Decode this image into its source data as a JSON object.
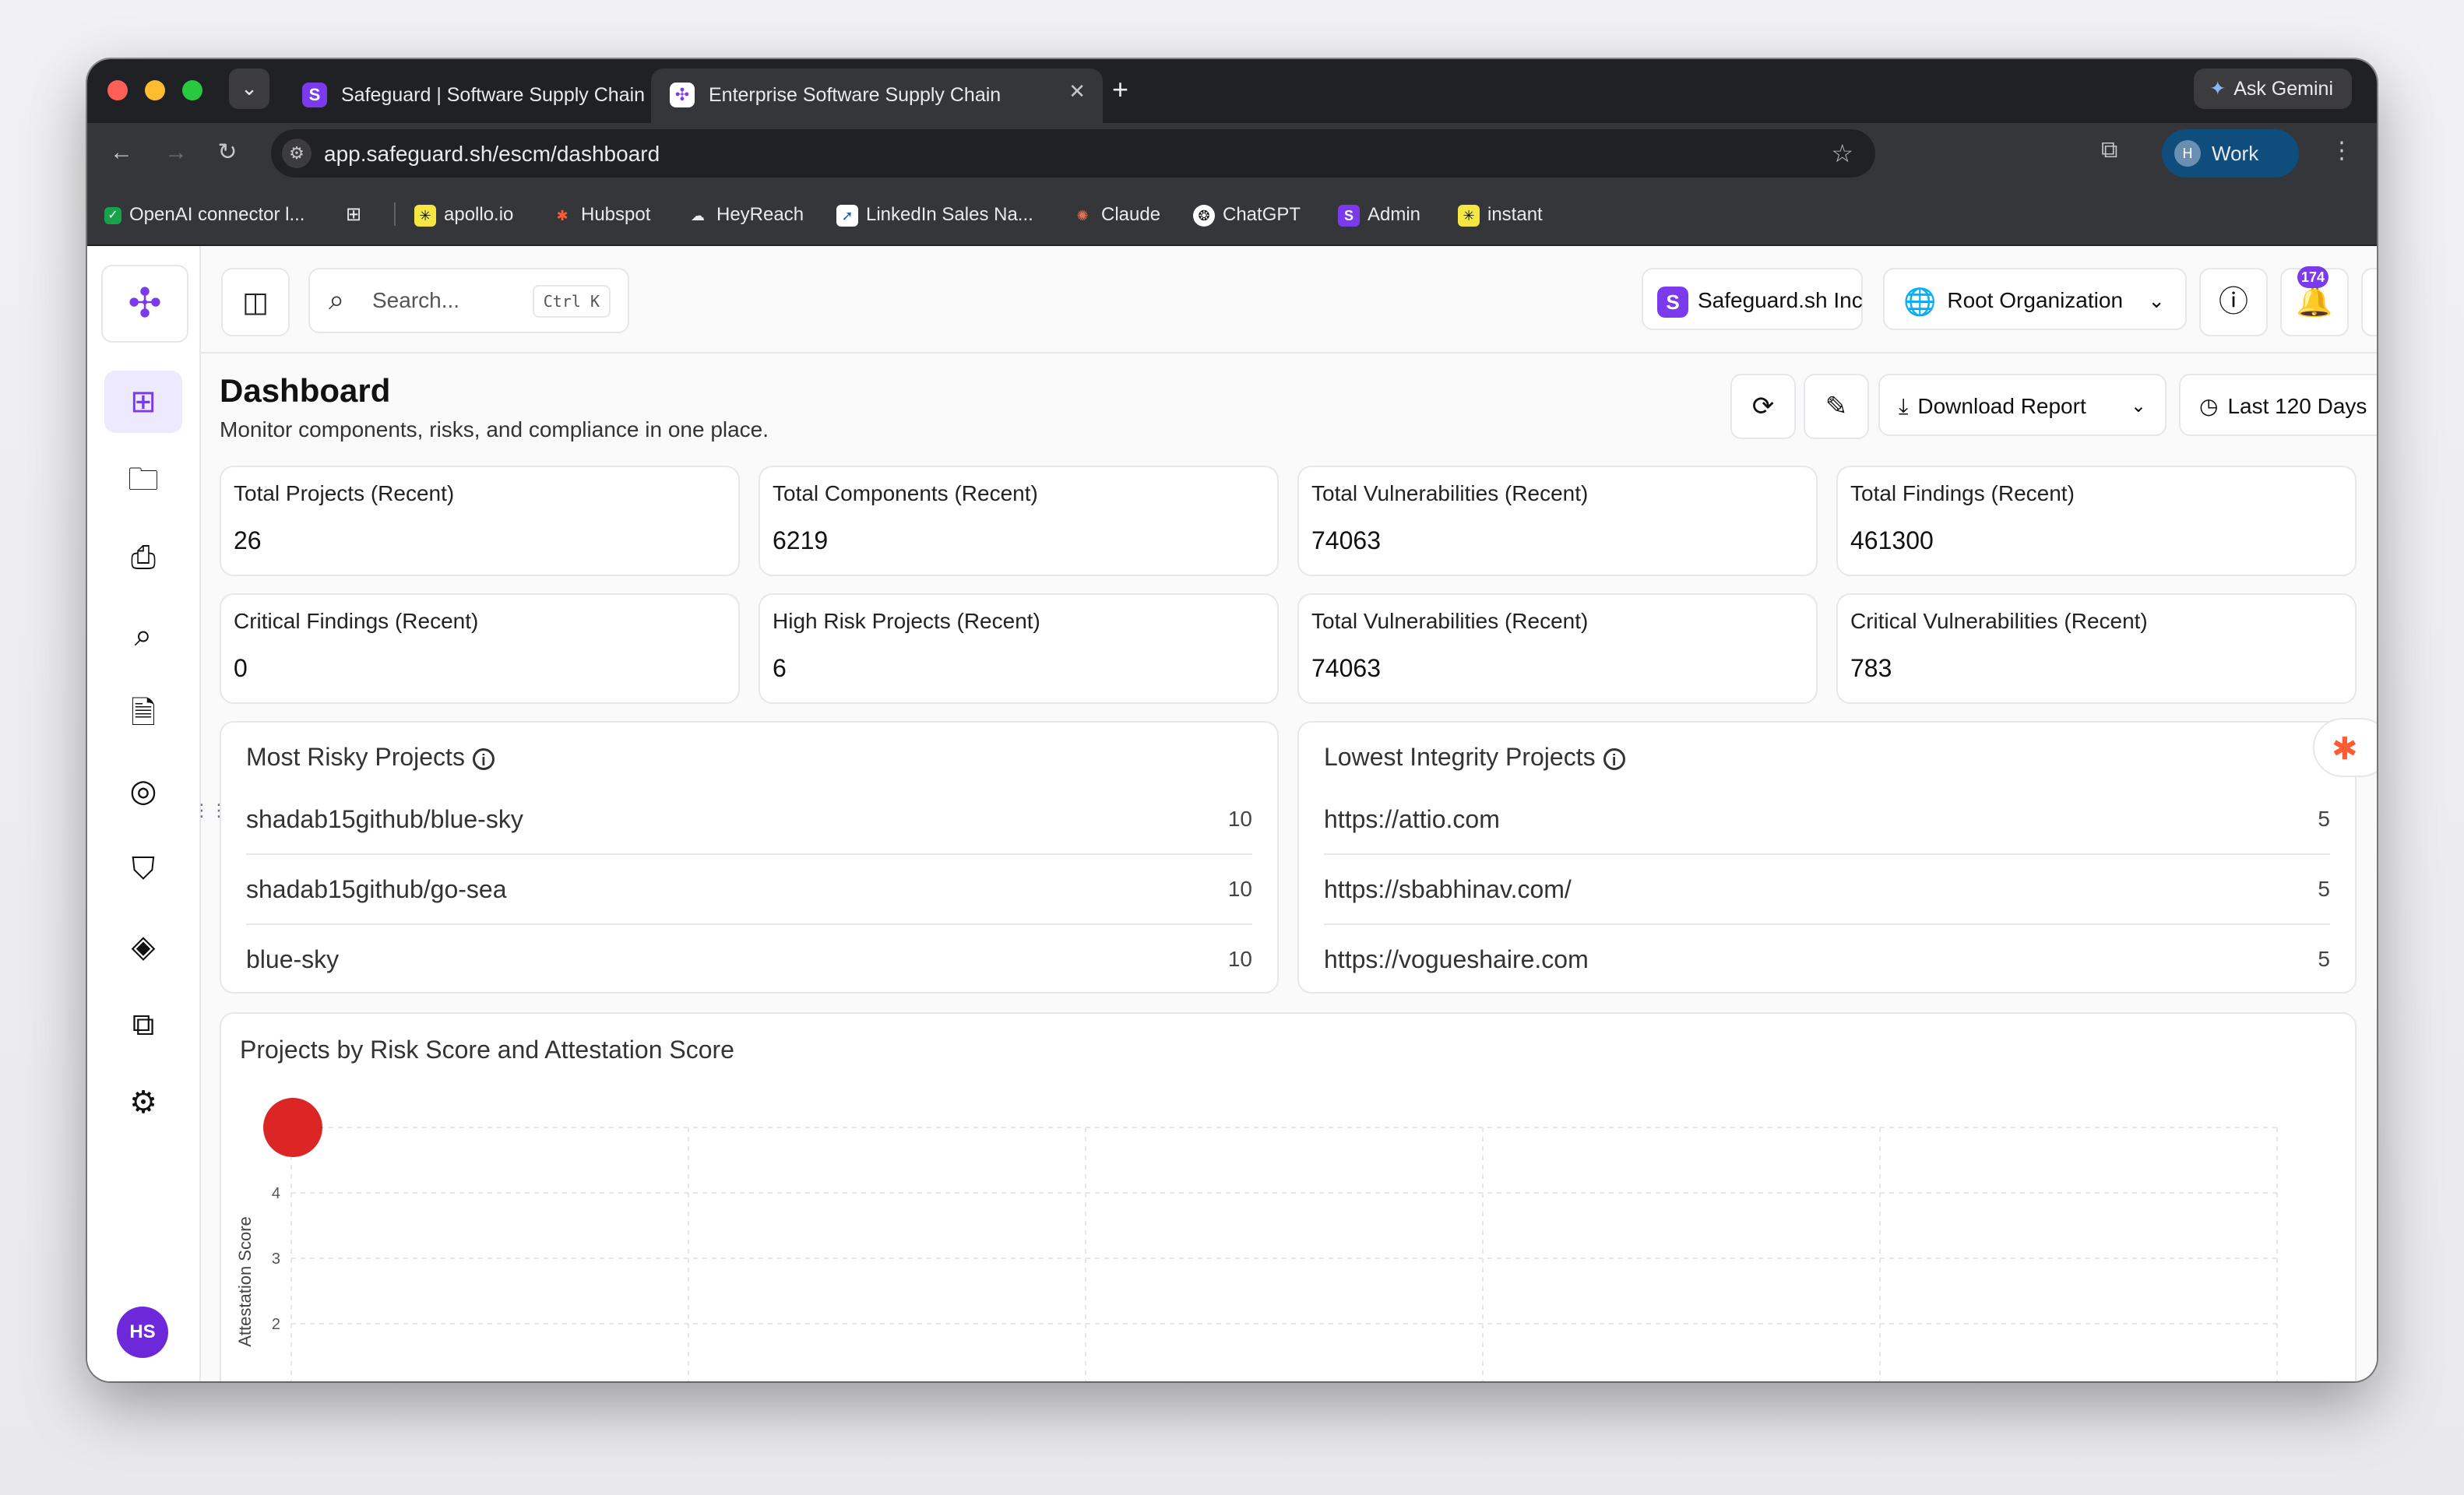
{
  "browser": {
    "tabs": [
      {
        "title": "Safeguard | Software Supply Chain",
        "active": false
      },
      {
        "title": "Enterprise Software Supply Chain",
        "active": true
      }
    ],
    "ask_gemini": "Ask Gemini",
    "url": "app.safeguard.sh/escm/dashboard",
    "profile_initial": "H",
    "profile_label": "Work",
    "bookmarks": [
      "OpenAI connector l...",
      "apollo.io",
      "Hubspot",
      "HeyReach",
      "LinkedIn Sales Na...",
      "Claude",
      "ChatGPT",
      "Admin",
      "instant"
    ]
  },
  "topbar": {
    "search_placeholder": "Search...",
    "search_shortcut": "Ctrl K",
    "org_name": "Safeguard.sh Inc",
    "root_org": "Root Organization",
    "notifications_count": "174"
  },
  "sidebar": {
    "items": [
      "dashboard",
      "projects",
      "inbox",
      "search",
      "reports",
      "risk",
      "compliance",
      "components",
      "integrations",
      "settings"
    ],
    "user_initials": "HS"
  },
  "header": {
    "title": "Dashboard",
    "subtitle": "Monitor components, risks, and compliance in one place.",
    "download_label": "Download Report",
    "range_label": "Last 120 Days"
  },
  "stats": [
    {
      "label": "Total Projects (Recent)",
      "value": "26"
    },
    {
      "label": "Total Components (Recent)",
      "value": "6219"
    },
    {
      "label": "Total Vulnerabilities (Recent)",
      "value": "74063"
    },
    {
      "label": "Total Findings (Recent)",
      "value": "461300"
    },
    {
      "label": "Critical Findings (Recent)",
      "value": "0"
    },
    {
      "label": "High Risk Projects (Recent)",
      "value": "6"
    },
    {
      "label": "Total Vulnerabilities (Recent)",
      "value": "74063"
    },
    {
      "label": "Critical Vulnerabilities (Recent)",
      "value": "783"
    }
  ],
  "risky_projects": {
    "title": "Most Risky Projects",
    "items": [
      {
        "name": "shadab15github/blue-sky",
        "score": "10"
      },
      {
        "name": "shadab15github/go-sea",
        "score": "10"
      },
      {
        "name": "blue-sky",
        "score": "10"
      }
    ]
  },
  "integrity_projects": {
    "title": "Lowest Integrity Projects",
    "items": [
      {
        "name": "https://attio.com",
        "score": "5"
      },
      {
        "name": "https://sbabhinav.com/",
        "score": "5"
      },
      {
        "name": "https://vogueshaire.com",
        "score": "5"
      }
    ]
  },
  "chart_data": {
    "type": "scatter",
    "title": "Projects by Risk Score and Attestation Score",
    "xlabel": "",
    "ylabel": "Attestation Score",
    "y_ticks": [
      2,
      3,
      4
    ],
    "points": [
      {
        "x": 0,
        "y": 5,
        "color": "#dc2626"
      }
    ],
    "grid": true
  },
  "colors": {
    "accent": "#7c3aed",
    "point": "#dc2626",
    "hubspot": "#ff5c35"
  }
}
